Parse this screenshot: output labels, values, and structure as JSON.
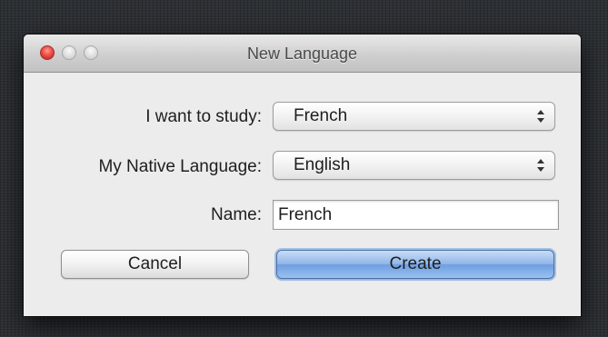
{
  "window": {
    "title": "New Language"
  },
  "form": {
    "study_label": "I want to study:",
    "study_value": "French",
    "native_label": "My Native Language:",
    "native_value": "English",
    "name_label": "Name:",
    "name_value": "French"
  },
  "buttons": {
    "cancel_label": "Cancel",
    "create_label": "Create"
  },
  "colors": {
    "default_button": "#7aa6e6",
    "close_button": "#ee4f45",
    "window_bg": "#ececec"
  }
}
